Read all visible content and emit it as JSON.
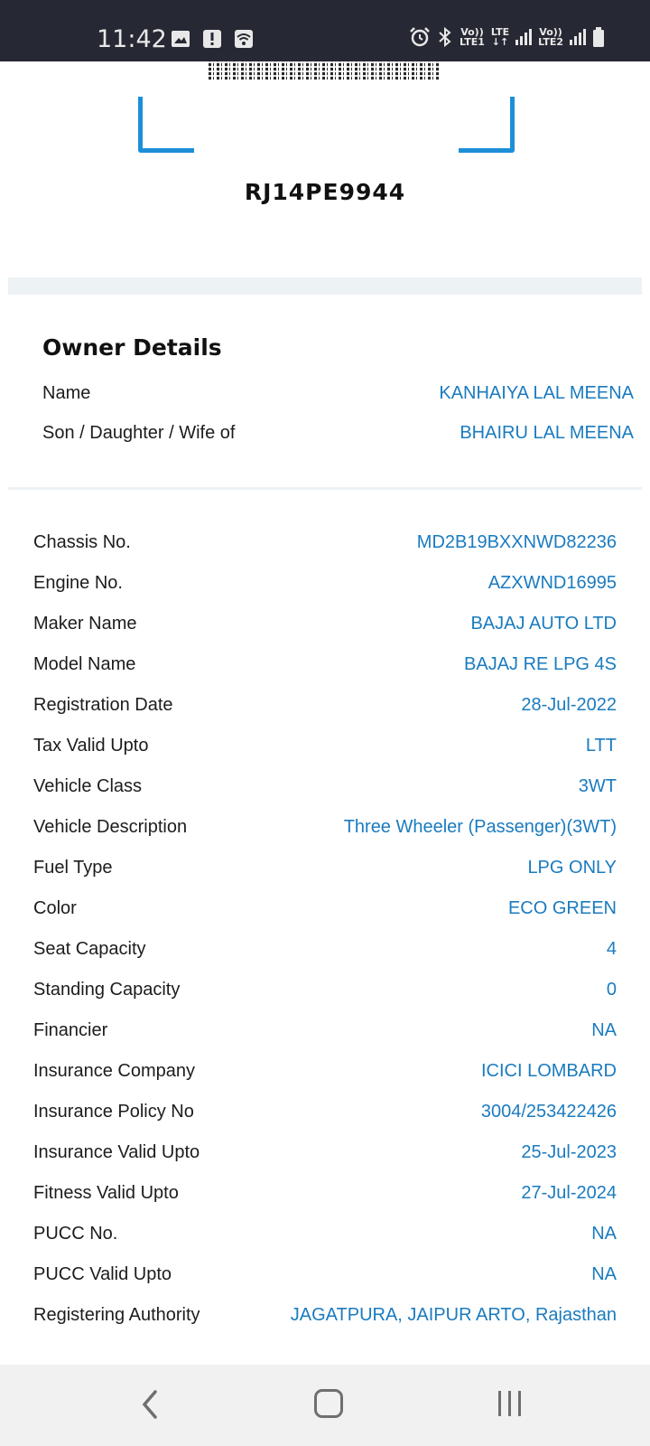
{
  "status_bar": {
    "time": "11:42",
    "network1_top": "Vo))",
    "network1_bottom": "LTE1",
    "lte_top": "LTE",
    "lte_bottom": "↓↑",
    "network2_top": "Vo))",
    "network2_bottom": "LTE2",
    "icons": [
      "gallery-icon",
      "alert-icon",
      "wifi-hotspot-icon",
      "alarm-icon",
      "bluetooth-icon",
      "signal-icon",
      "battery-icon"
    ]
  },
  "vehicle": {
    "registration_number": "RJ14PE9944"
  },
  "owner": {
    "title": "Owner Details",
    "fields": [
      {
        "label": "Name",
        "value": "KANHAIYA LAL MEENA"
      },
      {
        "label": "Son / Daughter / Wife of",
        "value": "BHAIRU LAL MEENA"
      }
    ]
  },
  "details": [
    {
      "label": "Chassis No.",
      "value": "MD2B19BXXNWD82236"
    },
    {
      "label": "Engine No.",
      "value": "AZXWND16995"
    },
    {
      "label": "Maker Name",
      "value": "BAJAJ AUTO LTD"
    },
    {
      "label": "Model Name",
      "value": "BAJAJ RE LPG 4S"
    },
    {
      "label": "Registration Date",
      "value": "28-Jul-2022"
    },
    {
      "label": "Tax Valid Upto",
      "value": "LTT"
    },
    {
      "label": "Vehicle Class",
      "value": "3WT"
    },
    {
      "label": "Vehicle Description",
      "value": "Three Wheeler (Passenger)(3WT)"
    },
    {
      "label": "Fuel Type",
      "value": "LPG ONLY"
    },
    {
      "label": "Color",
      "value": "ECO GREEN"
    },
    {
      "label": "Seat Capacity",
      "value": "4"
    },
    {
      "label": "Standing Capacity",
      "value": "0"
    },
    {
      "label": "Financier",
      "value": "NA"
    },
    {
      "label": "Insurance Company",
      "value": "ICICI  LOMBARD"
    },
    {
      "label": "Insurance Policy No",
      "value": "3004/253422426"
    },
    {
      "label": "Insurance Valid Upto",
      "value": "25-Jul-2023"
    },
    {
      "label": "Fitness Valid Upto",
      "value": "27-Jul-2024"
    },
    {
      "label": "PUCC No.",
      "value": "NA"
    },
    {
      "label": "PUCC Valid Upto",
      "value": "NA"
    },
    {
      "label": "Registering Authority",
      "value": "JAGATPURA, JAIPUR ARTO, Rajasthan"
    }
  ],
  "colors": {
    "accent": "#1d8fd8",
    "value_text": "#1a7bbf",
    "status_bar": "#262833"
  }
}
